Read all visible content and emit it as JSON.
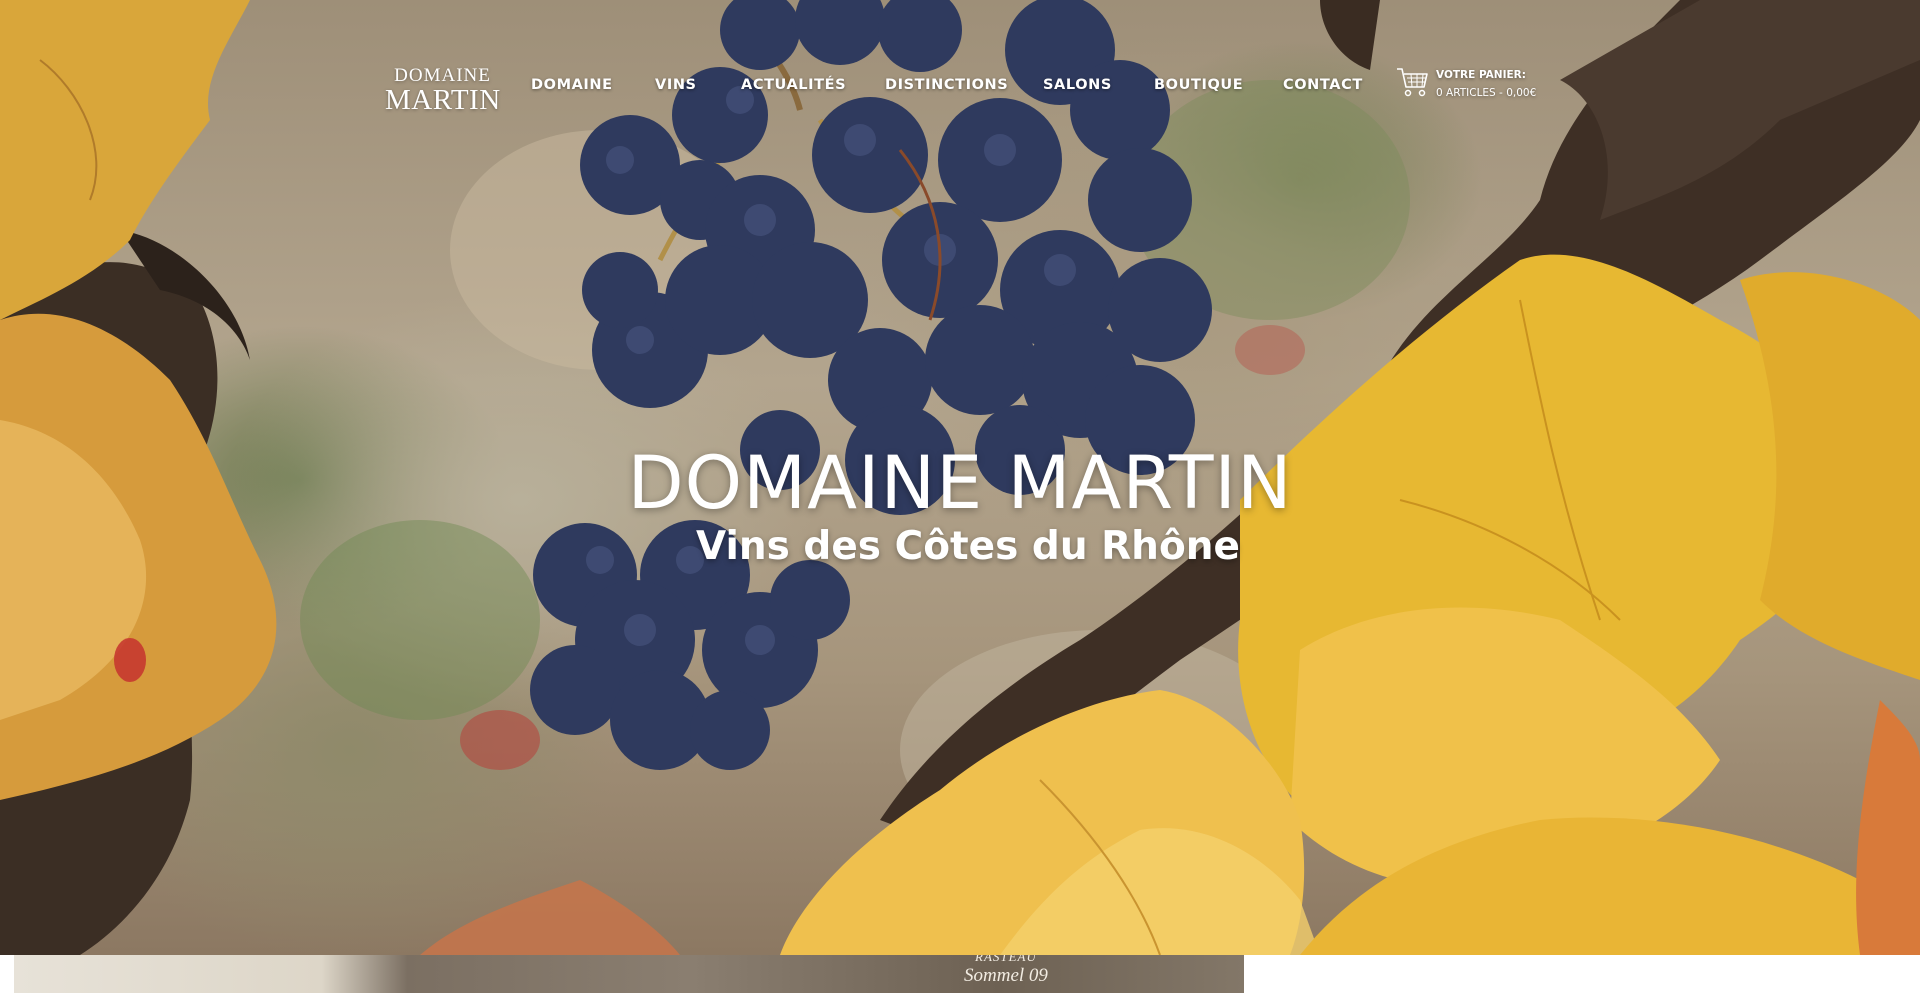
{
  "logo": {
    "line1": "DOMAINE",
    "line2": "MARTIN"
  },
  "nav": {
    "items": [
      {
        "label": "DOMAINE"
      },
      {
        "label": "VINS"
      },
      {
        "label": "ACTUALITÉS"
      },
      {
        "label": "DISTINCTIONS"
      },
      {
        "label": "SALONS"
      },
      {
        "label": "BOUTIQUE"
      },
      {
        "label": "CONTACT"
      }
    ]
  },
  "cart": {
    "title": "VOTRE PANIER:",
    "summary": "0 ARTICLES - 0,00€",
    "icon": "shopping-cart-icon"
  },
  "hero": {
    "title": "DOMAINE MARTIN",
    "subtitle": "Vins des Côtes du Rhône"
  },
  "strip": {
    "line1": "RASTEAU",
    "line2": "Sommel 09"
  },
  "colors": {
    "nav_text": "#ffffff",
    "grape": "#2f3a5e",
    "leaf": "#e8b93a",
    "bark": "#3e2f25"
  }
}
